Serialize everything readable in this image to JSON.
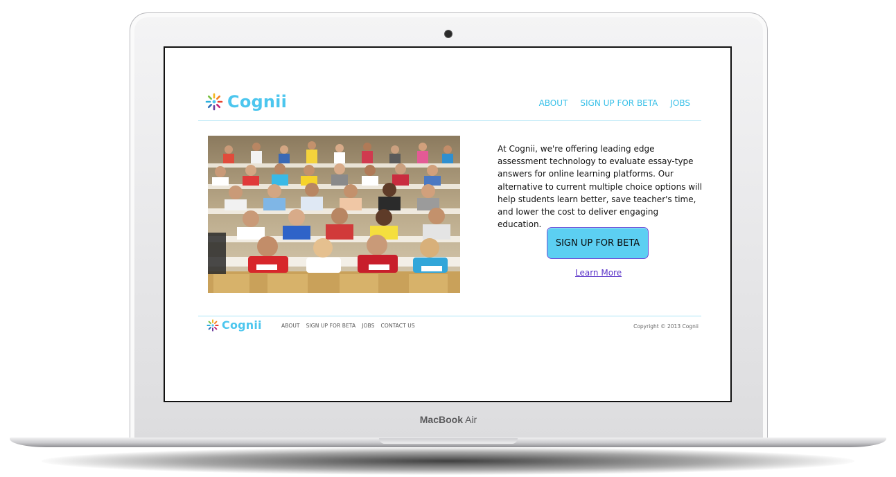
{
  "device": {
    "brand_bold": "MacBook",
    "brand_light": "Air"
  },
  "site": {
    "logo_text": "Cognii",
    "nav": [
      {
        "label": "ABOUT"
      },
      {
        "label": "SIGN UP FOR BETA"
      },
      {
        "label": "JOBS"
      }
    ],
    "photo_alt": "students in lecture hall",
    "intro": "At Cognii, we're offering leading edge assessment technology to evaluate essay-type answers for online learning platforms. Our alternative to current multiple choice options will help students learn better, save teacher's time, and lower the cost to deliver engaging education.",
    "cta_label": "SIGN UP FOR BETA",
    "learn_more": "Learn More",
    "footer": {
      "logo_text": "Cognii",
      "nav": [
        {
          "label": "ABOUT"
        },
        {
          "label": "SIGN UP FOR BETA"
        },
        {
          "label": "JOBS"
        },
        {
          "label": "CONTACT US"
        }
      ],
      "copyright": "Copyright © 2013 Cognii"
    },
    "colors": {
      "accent": "#4cc6ee",
      "button": "#5ccff2",
      "link": "#5b34c9"
    }
  }
}
